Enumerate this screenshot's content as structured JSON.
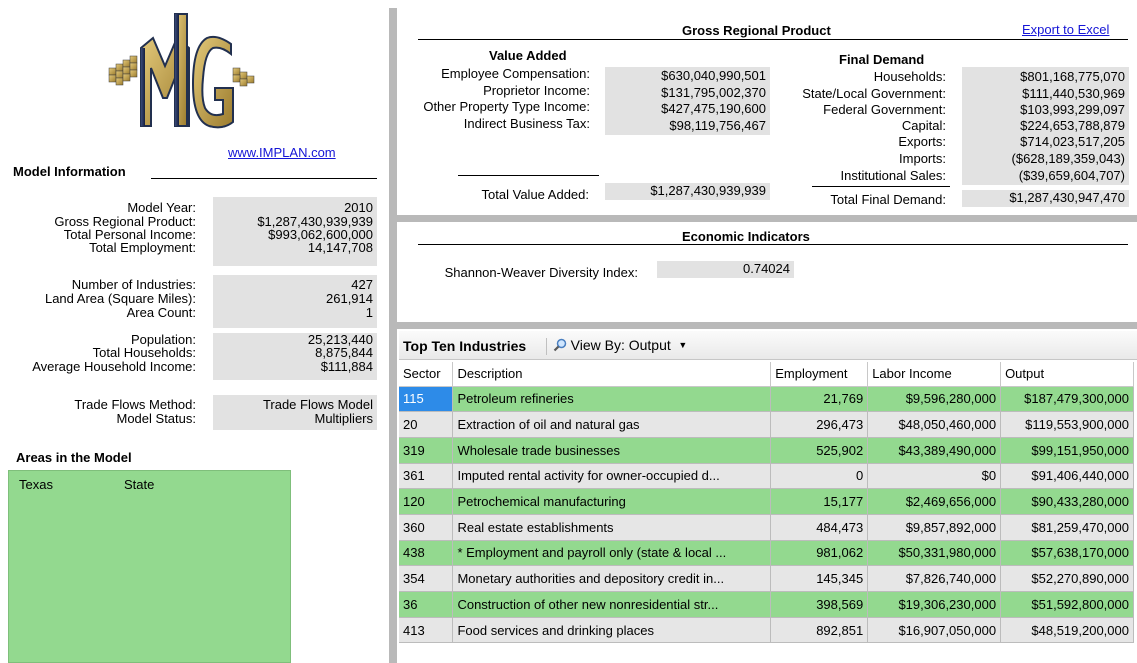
{
  "logo": {
    "text": "MIG",
    "website": "www.IMPLAN.com"
  },
  "model_info": {
    "title": "Model Information",
    "rows": [
      {
        "label": "Model Year:",
        "value": "2010"
      },
      {
        "label": "Gross Regional Product:",
        "value": "$1,287,430,939,939"
      },
      {
        "label": "Total Personal Income:",
        "value": "$993,062,600,000"
      },
      {
        "label": "Total Employment:",
        "value": "14,147,708"
      },
      {
        "label": "Number of Industries:",
        "value": "427"
      },
      {
        "label": "Land Area (Square Miles):",
        "value": "261,914"
      },
      {
        "label": "Area Count:",
        "value": "1"
      },
      {
        "label": "Population:",
        "value": "25,213,440"
      },
      {
        "label": "Total Households:",
        "value": "8,875,844"
      },
      {
        "label": "Average Household Income:",
        "value": "$111,884"
      },
      {
        "label": "Trade Flows Method:",
        "value": "Trade Flows Model"
      },
      {
        "label": "Model Status:",
        "value": "Multipliers"
      }
    ]
  },
  "areas": {
    "title": "Areas in the Model",
    "items": [
      {
        "name": "Texas",
        "type": "State"
      }
    ]
  },
  "grp": {
    "title": "Gross Regional Product",
    "export_link": "Export to Excel",
    "value_added": {
      "title": "Value Added",
      "rows": [
        {
          "label": "Employee Compensation:",
          "value": "$630,040,990,501"
        },
        {
          "label": "Proprietor Income:",
          "value": "$131,795,002,370"
        },
        {
          "label": "Other Property Type Income:",
          "value": "$427,475,190,600"
        },
        {
          "label": "Indirect Business Tax:",
          "value": "$98,119,756,467"
        }
      ],
      "total_label": "Total Value Added:",
      "total_value": "$1,287,430,939,939"
    },
    "final_demand": {
      "title": "Final Demand",
      "rows": [
        {
          "label": "Households:",
          "value": "$801,168,775,070"
        },
        {
          "label": "State/Local Government:",
          "value": "$111,440,530,969"
        },
        {
          "label": "Federal Government:",
          "value": "$103,993,299,097"
        },
        {
          "label": "Capital:",
          "value": "$224,653,788,879"
        },
        {
          "label": "Exports:",
          "value": "$714,023,517,205"
        },
        {
          "label": "Imports:",
          "value": "($628,189,359,043)"
        },
        {
          "label": "Institutional Sales:",
          "value": "($39,659,604,707)"
        }
      ],
      "total_label": "Total Final Demand:",
      "total_value": "$1,287,430,947,470"
    }
  },
  "econ": {
    "title": "Economic Indicators",
    "label": "Shannon-Weaver Diversity Index:",
    "value": "0.74024"
  },
  "top_ten": {
    "title": "Top Ten Industries",
    "view_by": "View By: Output",
    "columns": [
      "Sector",
      "Description",
      "Employment",
      "Labor Income",
      "Output"
    ],
    "rows": [
      {
        "sector": "115",
        "description": "Petroleum refineries",
        "employment": "21,769",
        "labor_income": "$9,596,280,000",
        "output": "$187,479,300,000"
      },
      {
        "sector": "20",
        "description": "Extraction of oil and natural gas",
        "employment": "296,473",
        "labor_income": "$48,050,460,000",
        "output": "$119,553,900,000"
      },
      {
        "sector": "319",
        "description": "Wholesale trade businesses",
        "employment": "525,902",
        "labor_income": "$43,389,490,000",
        "output": "$99,151,950,000"
      },
      {
        "sector": "361",
        "description": "Imputed rental activity for owner-occupied d...",
        "employment": "0",
        "labor_income": "$0",
        "output": "$91,406,440,000"
      },
      {
        "sector": "120",
        "description": "Petrochemical manufacturing",
        "employment": "15,177",
        "labor_income": "$2,469,656,000",
        "output": "$90,433,280,000"
      },
      {
        "sector": "360",
        "description": "Real estate establishments",
        "employment": "484,473",
        "labor_income": "$9,857,892,000",
        "output": "$81,259,470,000"
      },
      {
        "sector": "438",
        "description": "* Employment and payroll only (state & local ...",
        "employment": "981,062",
        "labor_income": "$50,331,980,000",
        "output": "$57,638,170,000"
      },
      {
        "sector": "354",
        "description": "Monetary authorities and depository credit in...",
        "employment": "145,345",
        "labor_income": "$7,826,740,000",
        "output": "$52,270,890,000"
      },
      {
        "sector": "36",
        "description": "Construction of other new nonresidential str...",
        "employment": "398,569",
        "labor_income": "$19,306,230,000",
        "output": "$51,592,800,000"
      },
      {
        "sector": "413",
        "description": "Food services and drinking places",
        "employment": "892,851",
        "labor_income": "$16,907,050,000",
        "output": "$48,519,200,000"
      }
    ]
  }
}
